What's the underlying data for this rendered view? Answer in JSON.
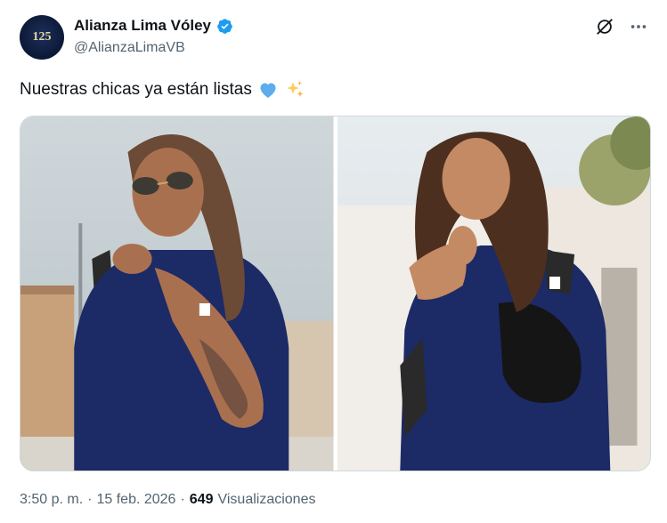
{
  "author": {
    "display_name": "Alianza Lima Vóley",
    "handle": "@AlianzaLimaVB",
    "avatar_text": "125"
  },
  "tweet": {
    "text": "Nuestras chicas ya están listas",
    "emojis": [
      "blue-heart",
      "sparkles"
    ]
  },
  "media": [
    {
      "description_icon": "photo-player-blowing-kiss"
    },
    {
      "description_icon": "photo-player-heart-gesture"
    }
  ],
  "meta": {
    "time": "3:50 p. m.",
    "separator": "·",
    "date": "15 feb. 2026",
    "views_count": "649",
    "views_label": "Visualizaciones"
  },
  "colors": {
    "verified": "#1d9bf0",
    "text_primary": "#0f1419",
    "text_secondary": "#536471",
    "jersey_navy": "#1c2a66"
  }
}
